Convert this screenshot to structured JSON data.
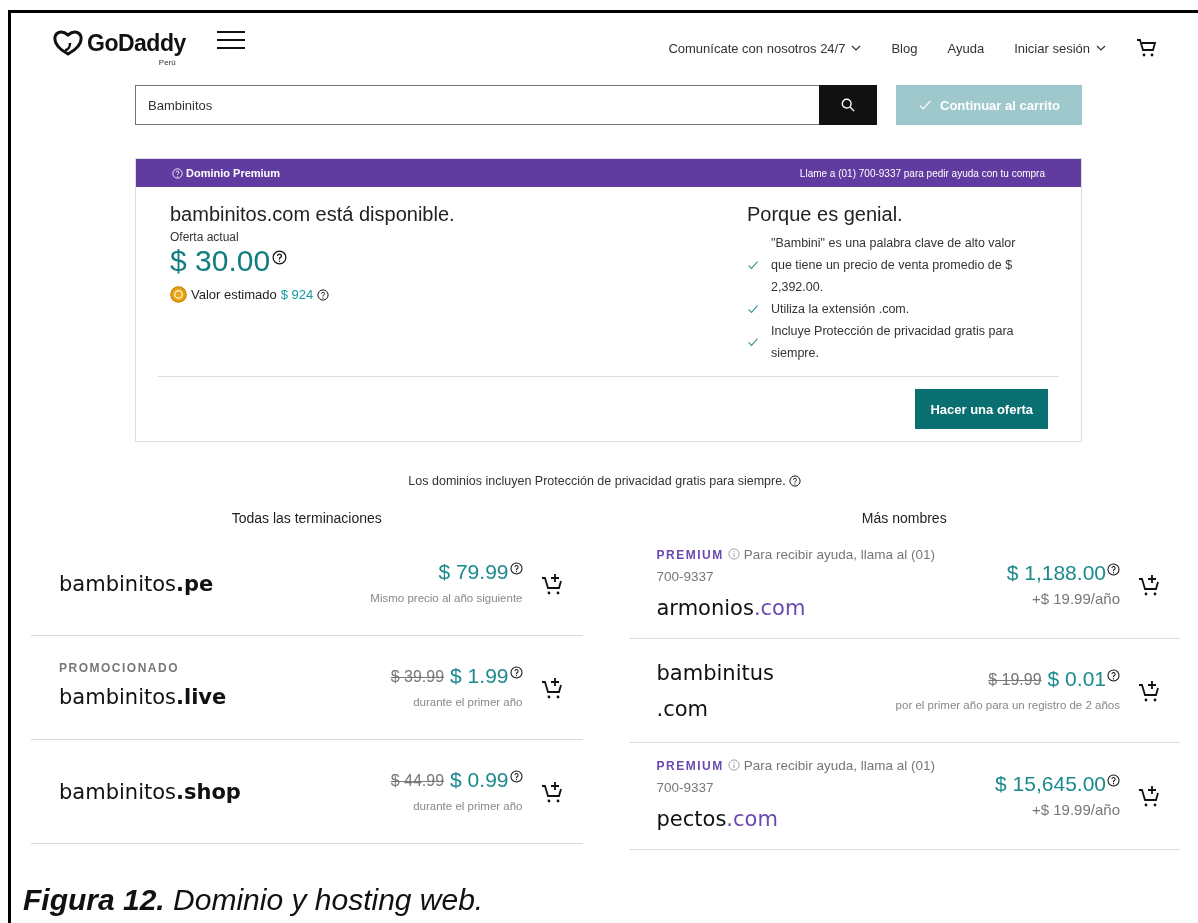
{
  "header": {
    "logo": "GoDaddy",
    "region": "Perú",
    "nav": [
      {
        "label": "Comunícate con nosotros 24/7",
        "has_menu": true
      },
      {
        "label": "Blog",
        "has_menu": false
      },
      {
        "label": "Ayuda",
        "has_menu": false
      },
      {
        "label": "Iniciar sesión",
        "has_menu": true
      }
    ]
  },
  "search": {
    "value": "Bambinitos",
    "continue_button": {
      "label": "Continuar al carrito",
      "disabled": true
    }
  },
  "premium_card": {
    "badge": "Dominio Premium",
    "help_line": "Llame a (01) 700-9337 para pedir ayuda con tu compra",
    "title": "bambinitos.com está disponible.",
    "offer_label": "Oferta actual",
    "offer_price": "$ 30.00",
    "estimate_label": "Valor estimado",
    "estimate_value": "$ 924",
    "reasons_title": "Porque es genial.",
    "reasons": [
      "\"Bambini\" es una palabra clave de alto valor que tiene un precio de venta promedio de $ 2,392.00.",
      "Utiliza la extensión .com.",
      "Incluye Protección de privacidad gratis para siempre."
    ],
    "offer_button": "Hacer una oferta"
  },
  "privacy_note": "Los dominios incluyen Protección de privacidad gratis para siempre.",
  "columns": [
    {
      "title": "Todas las terminaciones",
      "results": [
        {
          "kind": "standard",
          "name": "bambinitos",
          "tld": ".pe",
          "tld_bold": true,
          "price": "$ 79.99",
          "note": "Mismo precio al año siguiente"
        },
        {
          "kind": "promoted",
          "label": "PROMOCIONADO",
          "name": "bambinitos",
          "tld": ".live",
          "tld_bold": true,
          "old_price": "$ 39.99",
          "price": "$ 1.99",
          "note": "durante el primer año"
        },
        {
          "kind": "standard",
          "name": "bambinitos",
          "tld": ".shop",
          "tld_bold": true,
          "old_price": "$ 44.99",
          "price": "$ 0.99",
          "note": "durante el primer año"
        }
      ]
    },
    {
      "title": "Más nombres",
      "results": [
        {
          "kind": "premium",
          "label": "PREMIUM",
          "help": "Para recibir ayuda, llama al (01) 700-9337",
          "name": "armonios",
          "tld": ".com",
          "tld_bold": false,
          "price": "$ 1,188.00",
          "note": "+$ 19.99/año"
        },
        {
          "kind": "standard",
          "name": "bambinitus",
          "tld": ".com",
          "tld_bold": false,
          "old_price": "$ 19.99",
          "price": "$ 0.01",
          "note": "por el primer año para un registro de 2 años"
        },
        {
          "kind": "premium",
          "label": "PREMIUM",
          "help": "Para recibir ayuda, llama al (01) 700-9337",
          "name": "pectos",
          "tld": ".com",
          "tld_bold": false,
          "price": "$ 15,645.00",
          "note": "+$ 19.99/año"
        }
      ]
    }
  ],
  "caption": "**Figura 12.** Dominio y hosting web."
}
